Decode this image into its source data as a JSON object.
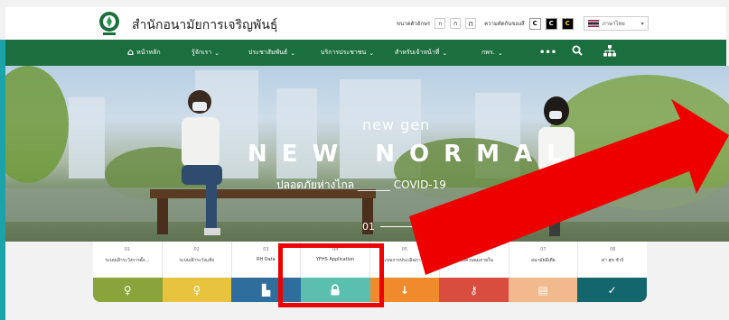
{
  "header": {
    "site_title": "สำนักอนามัยการเจริญพันธุ์",
    "font_size_label": "ขนาดตัวอักษร",
    "font_sizes": [
      "ก",
      "ก",
      "ก"
    ],
    "contrast_label": "ความตัดกันของสี",
    "contrast_options": [
      "C",
      "C",
      "C"
    ],
    "language": "ภาษาไทย"
  },
  "nav": {
    "items": [
      {
        "label": "หน้าหลัก",
        "icon": "home-icon"
      },
      {
        "label": "รู้จักเรา",
        "icon": "chevron-down-icon"
      },
      {
        "label": "ประชาสัมพันธ์",
        "icon": "chevron-down-icon"
      },
      {
        "label": "บริการประชาชน",
        "icon": "chevron-down-icon"
      },
      {
        "label": "สำหรับเจ้าหน้าที่",
        "icon": "chevron-down-icon"
      },
      {
        "label": "กพร.",
        "icon": "chevron-down-icon"
      }
    ],
    "more_icon": "•••",
    "search_icon": "search-icon",
    "sitemap_icon": "sitemap-icon"
  },
  "hero": {
    "subtitle": "new gen",
    "title": "NEW NORMAL",
    "tagline": "ปลอดภัยห่างไกล ______ COVID-19",
    "slide_number": "01"
  },
  "quick_links": [
    {
      "num": "01",
      "label": "ระบบเฝ้าระวังการตั้ง...",
      "color": "#8aa33a",
      "icon": "♀"
    },
    {
      "num": "02",
      "label": "ระบบเฝ้าระวังแท้ง",
      "color": "#e8c43e",
      "icon": "♀"
    },
    {
      "num": "03",
      "label": "RH Data",
      "color": "#2f6e9c",
      "icon": "▙"
    },
    {
      "num": "04",
      "label": "YFHS Application",
      "color": "#5bbfb0",
      "icon": "🔒"
    },
    {
      "num": "05",
      "label": "ระบบการประเมินการ...",
      "color": "#ef8b2c",
      "icon": "↓"
    },
    {
      "num": "06",
      "label": "ระบบควบคุมภายใน",
      "color": "#d94d3f",
      "icon": "⚷"
    },
    {
      "num": "07",
      "label": "อนามัยมีเดีย",
      "color": "#f2b98d",
      "icon": "▤"
    },
    {
      "num": "08",
      "label": "สา สุข ชัวร์",
      "color": "#13666c",
      "icon": "✓"
    }
  ]
}
